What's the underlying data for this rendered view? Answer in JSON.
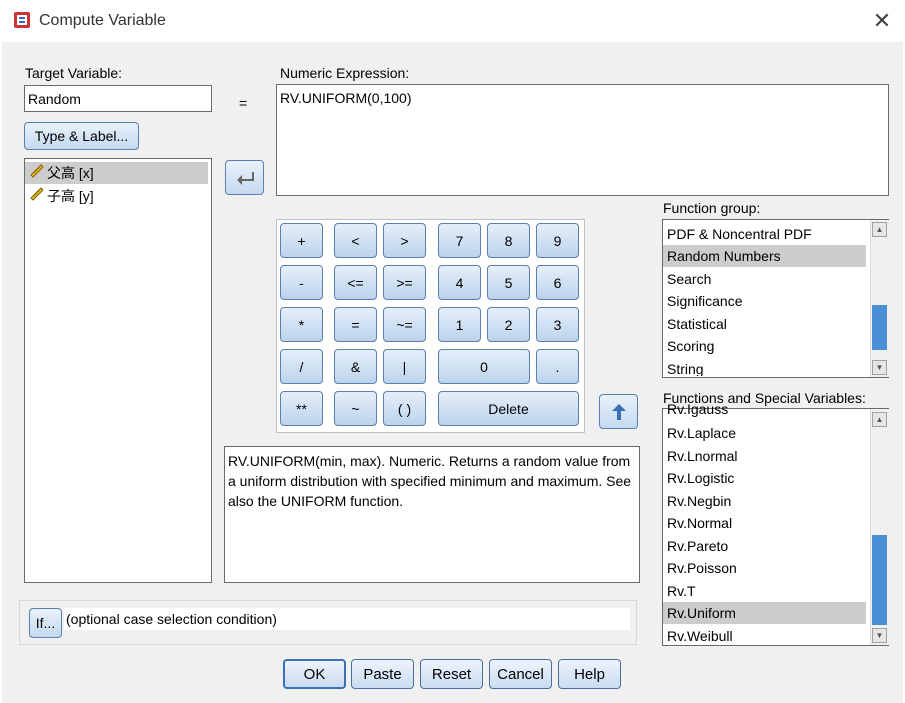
{
  "window": {
    "title": "Compute Variable",
    "close_glyph": "✕"
  },
  "target": {
    "label": "Target Variable:",
    "value": "Random",
    "type_label_button": "Type & Label..."
  },
  "equals": "=",
  "variables": [
    {
      "name": "父高 [x]",
      "icon": "ruler-icon",
      "selected": true
    },
    {
      "name": "子高 [y]",
      "icon": "ruler-icon",
      "selected": false
    }
  ],
  "expression": {
    "label": "Numeric Expression:",
    "value": "RV.UNIFORM(0,100)"
  },
  "calculator": {
    "rows": [
      [
        "+",
        "<",
        ">",
        "7",
        "8",
        "9"
      ],
      [
        "-",
        "<=",
        ">=",
        "4",
        "5",
        "6"
      ],
      [
        "*",
        "=",
        "~=",
        "1",
        "2",
        "3"
      ],
      [
        "/",
        "&",
        "|",
        "0",
        "."
      ],
      [
        "**",
        "~",
        "( )",
        "Delete"
      ]
    ]
  },
  "description": "RV.UNIFORM(min, max). Numeric. Returns a random value from a uniform distribution with specified minimum and maximum. See also the UNIFORM function.",
  "function_group": {
    "label": "Function group:",
    "items": [
      "PDF & Noncentral PDF",
      "Random Numbers",
      "Search",
      "Significance",
      "Statistical",
      "Scoring",
      "String"
    ],
    "selected_index": 1
  },
  "functions": {
    "label": "Functions and Special Variables:",
    "items": [
      "Rv.Igauss",
      "Rv.Laplace",
      "Rv.Lnormal",
      "Rv.Logistic",
      "Rv.Negbin",
      "Rv.Normal",
      "Rv.Pareto",
      "Rv.Poisson",
      "Rv.T",
      "Rv.Uniform",
      "Rv.Weibull"
    ],
    "selected_index": 9
  },
  "if": {
    "button": "If...",
    "condition": "(optional case selection condition)"
  },
  "buttons": {
    "ok": "OK",
    "paste": "Paste",
    "reset": "Reset",
    "cancel": "Cancel",
    "help": "Help"
  },
  "colors": {
    "selection": "#cccccc",
    "button_border": "#5a7fb0",
    "scrollbar_thumb": "#4a90d6"
  }
}
